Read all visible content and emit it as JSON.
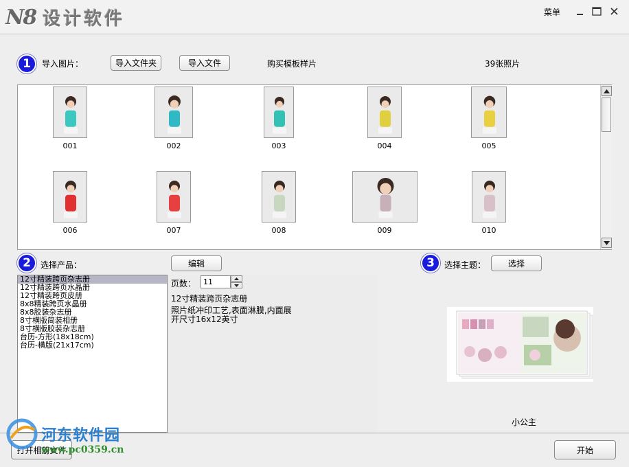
{
  "titlebar": {
    "logo_mark": "N8",
    "logo_text": "设计软件",
    "menu_label": "菜单"
  },
  "step1": {
    "number": "1",
    "label": "导入图片：",
    "import_folder_button": "导入文件夹",
    "import_file_button": "导入文件",
    "buy_template_link": "购买模板样片",
    "photo_count": "39张照片"
  },
  "photos": [
    {
      "caption": "001"
    },
    {
      "caption": "002"
    },
    {
      "caption": "003"
    },
    {
      "caption": "004"
    },
    {
      "caption": "005"
    },
    {
      "caption": "006"
    },
    {
      "caption": "007"
    },
    {
      "caption": "008"
    },
    {
      "caption": "009"
    },
    {
      "caption": "010"
    }
  ],
  "step2": {
    "number": "2",
    "label": "选择产品：",
    "edit_button": "编辑",
    "products": [
      "12寸精装跨页杂志册",
      "12寸精装跨页水晶册",
      "12寸精装跨页皮册",
      "8x8精装跨页水晶册",
      "8x8胶装杂志册",
      "8寸横版简装相册",
      "8寸横版胶装杂志册",
      "台历-方形(18x18cm)",
      "台历-横版(21x17cm)"
    ],
    "selected_index": 0,
    "pages_label": "页数：",
    "pages_value": "11",
    "product_name": "12寸精装跨页杂志册",
    "product_desc_1": "照片纸冲印工艺,表面淋膜,内面展",
    "product_desc_2": "开尺寸16x12英寸"
  },
  "step3": {
    "number": "3",
    "label": "选择主题：",
    "select_button": "选择",
    "theme_name": "小公主"
  },
  "bottom": {
    "open_album_button": "打开相册文件",
    "start_button": "开始"
  },
  "watermark": {
    "title": "河东软件园",
    "url": "www.pc0359.cn"
  },
  "colors": {
    "badge": "#1a1adc",
    "selection": "#b5b5c5",
    "watermark_blue": "#2a7fd0",
    "watermark_green": "#2f8f2f"
  }
}
